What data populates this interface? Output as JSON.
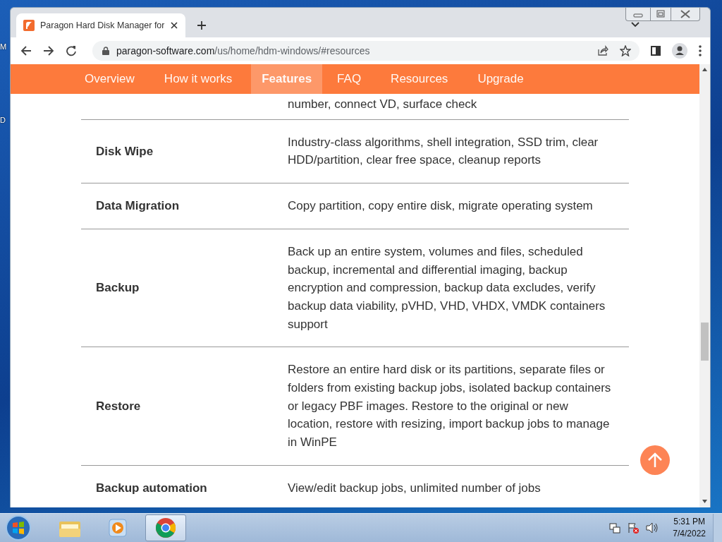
{
  "desktop": {
    "labels": [
      "M",
      "D"
    ]
  },
  "browser": {
    "tab": {
      "title": "Paragon Hard Disk Manager for",
      "selected": true
    },
    "address": {
      "host": "paragon-software.com",
      "path": "/us/home/hdm-windows/#resources"
    }
  },
  "nav": [
    {
      "label": "Overview",
      "selected": false
    },
    {
      "label": "How it works",
      "selected": false
    },
    {
      "label": "Features",
      "selected": true
    },
    {
      "label": "FAQ",
      "selected": false
    },
    {
      "label": "Resources",
      "selected": false
    },
    {
      "label": "Upgrade",
      "selected": false
    }
  ],
  "features": [
    {
      "description": "number, connect VD, surface check"
    },
    {
      "name": "Disk Wipe",
      "description": "Industry-class algorithms, shell integration, SSD trim, clear HDD/partition, clear free space, cleanup reports"
    },
    {
      "name": "Data Migration",
      "description": "Copy partition, copy entire disk, migrate operating system"
    },
    {
      "name": "Backup",
      "description": "Back up an entire system, volumes and files, scheduled backup, incremental and differential imaging, backup encryption and compression, backup data excludes, verify backup data viability, pVHD, VHD, VHDX, VMDK containers support"
    },
    {
      "name": "Restore",
      "description": "Restore an entire hard disk or its partitions, separate files or folders from existing backup jobs, isolated backup containers or legacy PBF images. Restore to the original or new location, restore with resizing, import backup jobs to manage in WinPE"
    },
    {
      "name": "Backup automation",
      "description": "View/edit backup jobs, unlimited number of jobs"
    }
  ],
  "taskbar": {
    "apps": [
      {
        "kind": "explorer",
        "selected": false
      },
      {
        "kind": "media",
        "selected": false
      },
      {
        "kind": "chrome",
        "selected": true
      }
    ],
    "time": "5:31 PM",
    "date": "7/4/2022"
  }
}
